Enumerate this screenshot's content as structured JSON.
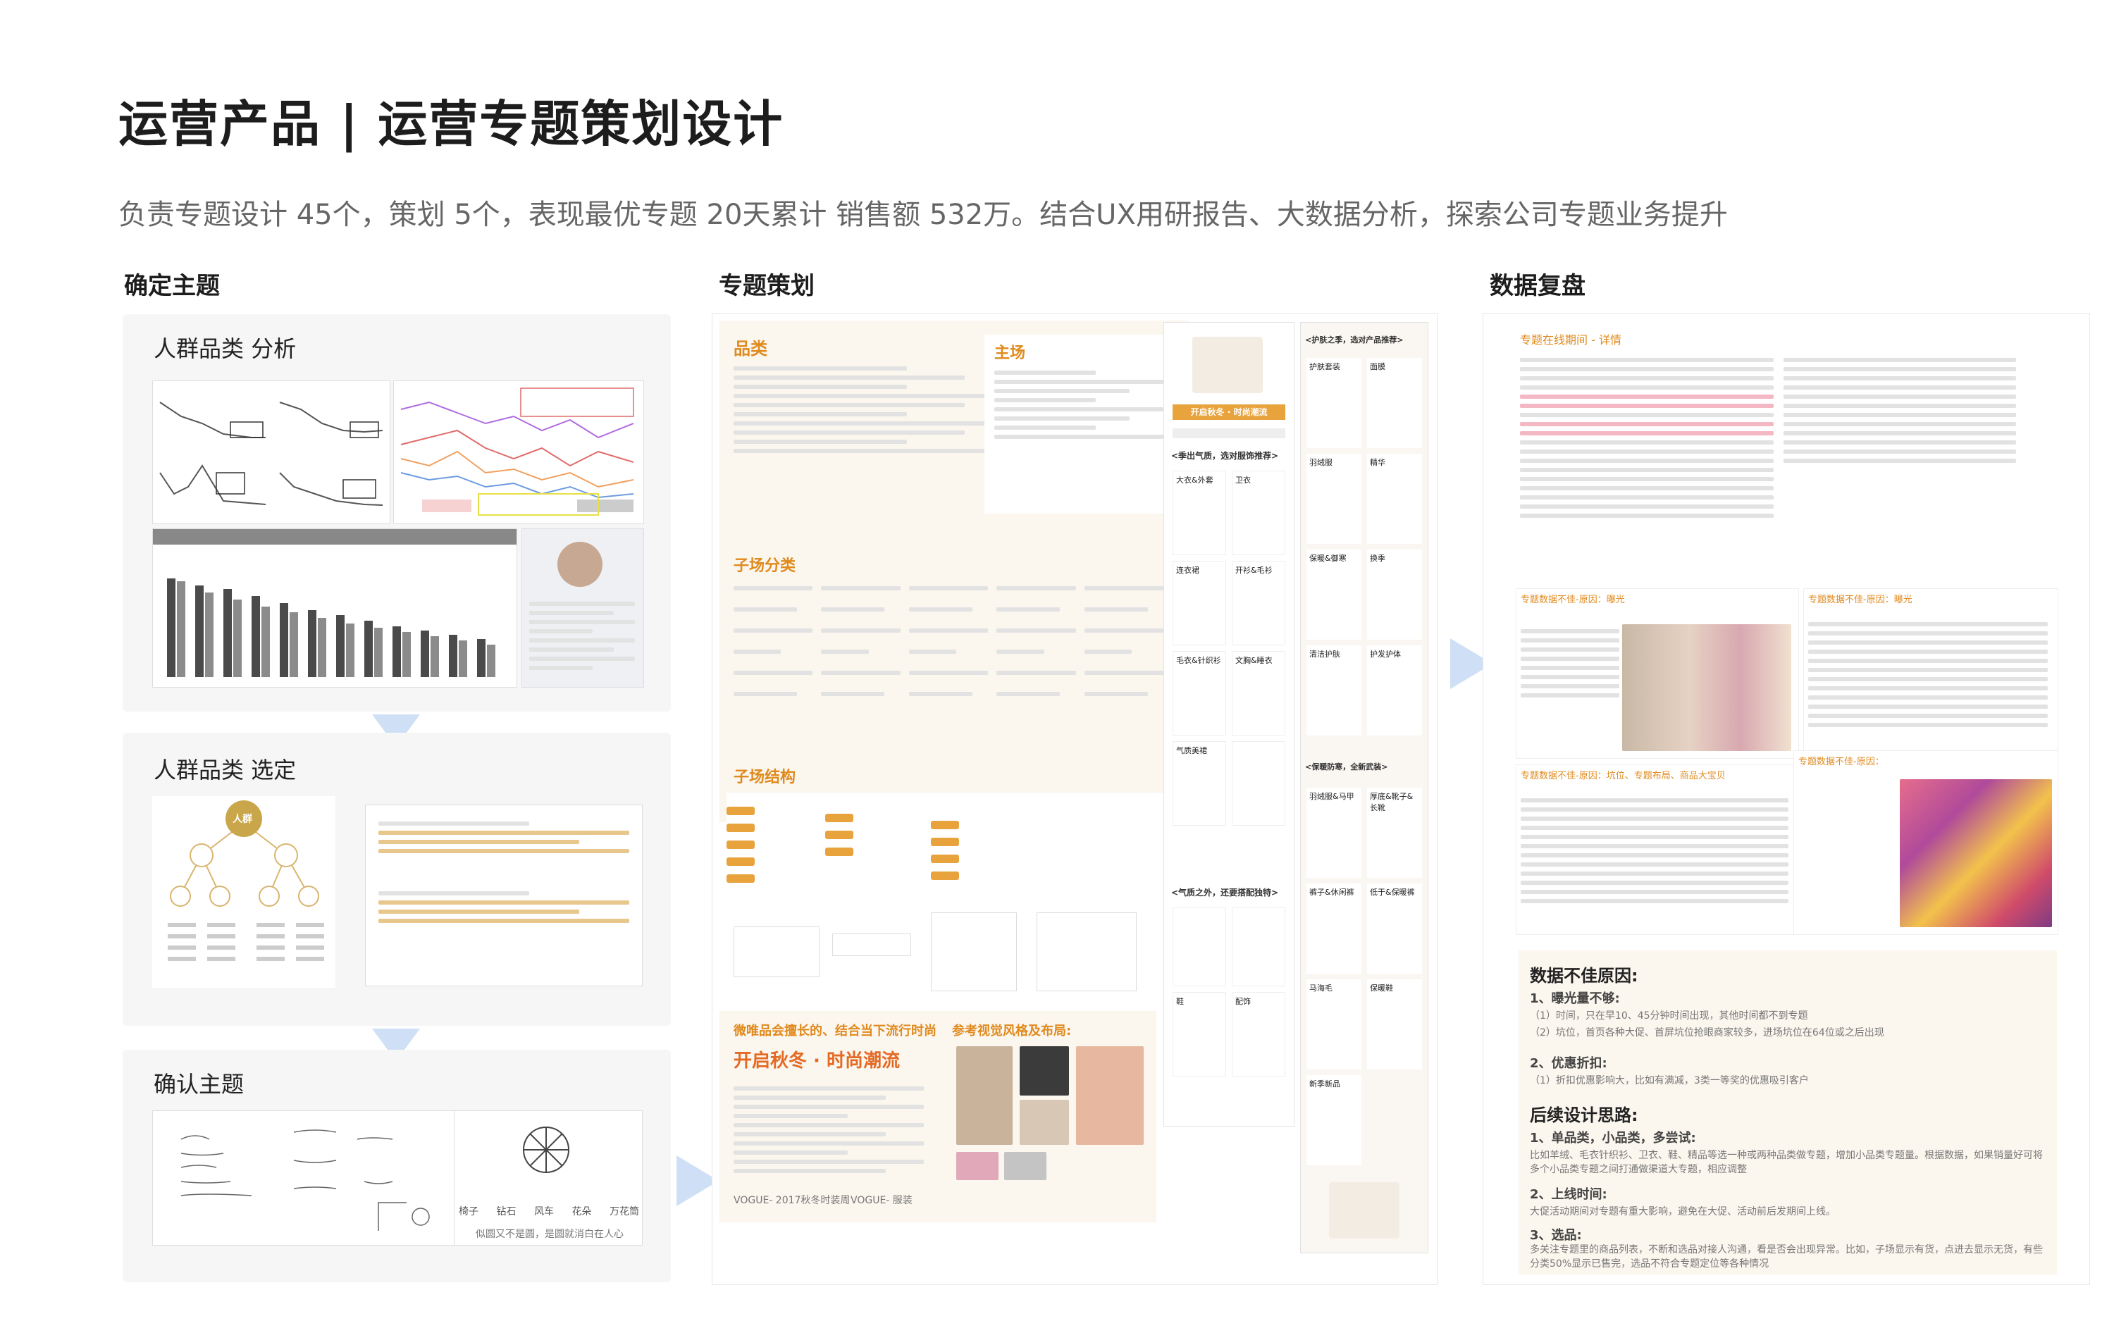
{
  "header": {
    "title": "运营产品 | 运营专题策划设计",
    "subtitle": "负责专题设计 45个，策划 5个，表现最优专题 20天累计 销售额 532万。结合UX用研报告、大数据分析，探索公司专题业务提升"
  },
  "columns": {
    "col1": "确定主题",
    "col2": "专题策划",
    "col3": "数据复盘"
  },
  "panels": {
    "analysis": "人群品类 分析",
    "selection": "人群品类 选定",
    "confirm": "确认主题"
  },
  "tree": {
    "root": "人群"
  },
  "confirm_items": [
    "椅子",
    "钻石",
    "风车",
    "花朵",
    "万花筒"
  ],
  "confirm_caption": "似圆又不是圆，是圆就消白在人心",
  "plan": {
    "category": "品类",
    "main": "主场",
    "sub_classify": "子场分类",
    "sub_structure": "子场结构",
    "slogan_note": "微唯品会擅长的、结合当下流行时尚",
    "ref_note": "参考视觉风格及布局:",
    "theme_big": "开启秋冬 · 时尚潮流",
    "phone_banner": "开启秋冬 · 时尚潮流",
    "vogue_left": "VOGUE- 2017秋冬时装周",
    "vogue_right": "VOGUE- 服装",
    "col_a_headers": [
      "<护肤之季，选对产品推荐>",
      "<季出气质，选对服饰推荐>",
      "<保暖防寒，全新武装>",
      "<气质之外，还要搭配独特>"
    ],
    "col_a_items": [
      "护肤套装",
      "面膜",
      "羽绒服",
      "精华",
      "大衣&外套",
      "卫衣",
      "保暖&御寒",
      "换季",
      "连衣裙",
      "开衫&毛衫",
      "清洁护肤",
      "护发护体",
      "毛衣&针织衫",
      "文胸&睡衣",
      "气质美裙",
      "羽绒服&马甲",
      "厚底&靴子&长靴",
      "裤子&休闲裤",
      "低于&保暖裤",
      "马海毛",
      "保暖鞋",
      "鞋",
      "配饰",
      "新季新品"
    ]
  },
  "review": {
    "table_title": "专题在线期间 - 详情",
    "chart1_title": "专题数据不佳-原因：曝光",
    "chart2_title": "专题数据不佳-原因：曝光",
    "chart3_title": "专题数据不佳-原因：坑位、专题布局、商品大宝贝",
    "chart4_title": "专题数据不佳-原因：",
    "reasons_heading": "数据不佳原因:",
    "reason1_title": "1、曝光量不够:",
    "reason1_a": "（1）时间，只在早10、45分钟时间出现，其他时间都不到专题",
    "reason1_b": "（2）坑位，首页各种大促、首屏坑位抢眼商家较多，进场坑位在64位或之后出现",
    "reason2_title": "2、优惠折扣:",
    "reason2_a": "（1）折扣优惠影响大，比如有满减，3类一等奖的优惠吸引客户",
    "followup_heading": "后续设计思路:",
    "follow1_title": "1、单品类，小品类，多尝试:",
    "follow1_text": "比如羊绒、毛衣针织衫、卫衣、鞋、精品等选一种或两种品类做专题，增加小品类专题量。根据数据，如果销量好可将多个小品类专题之间打通做渠道大专题，相应调整",
    "follow2_title": "2、上线时间:",
    "follow2_text": "大促活动期间对专题有重大影响，避免在大促、活动前后发期间上线。",
    "follow3_title": "3、选品:",
    "follow3_text": "多关注专题里的商品列表，不断和选品对接人沟通，看是否会出现异常。比如，子场显示有货，点进去显示无货，有些分类50%显示已售完，选品不符合专题定位等各种情况"
  },
  "colors": {
    "accent_gold": "#d6933a",
    "accent_orange": "#e08a1e",
    "arrow_blue": "#cfe0f6",
    "panel_bg": "#f6f6f7"
  }
}
